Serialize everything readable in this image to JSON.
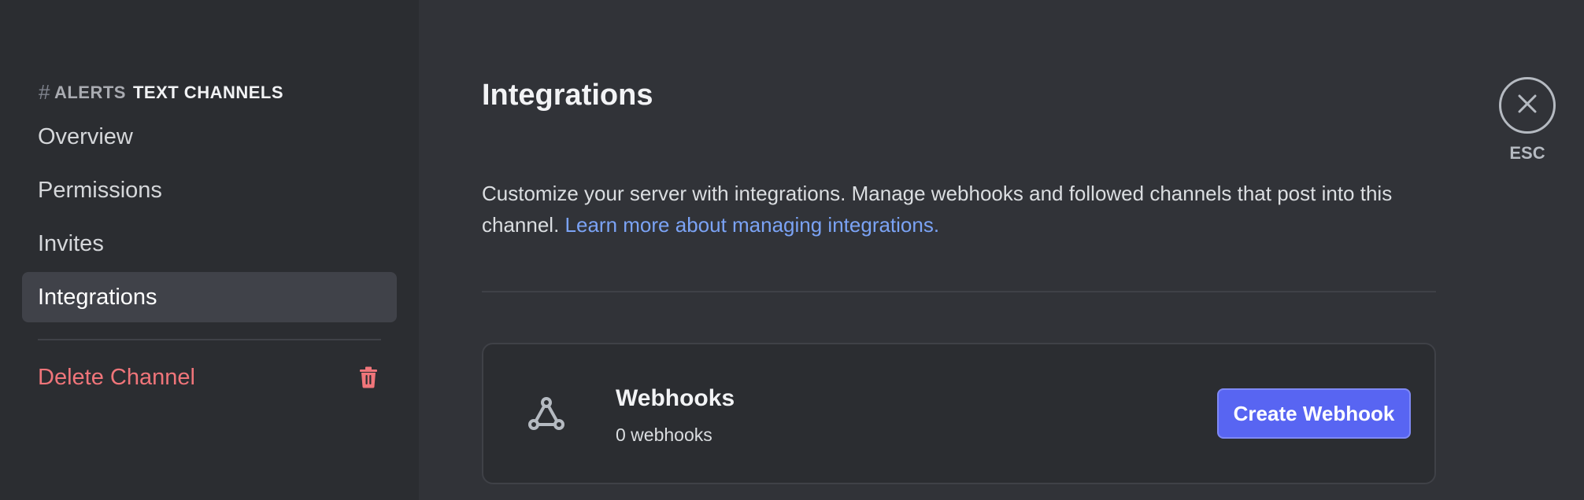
{
  "sidebar": {
    "header": {
      "hash": "#",
      "channel_name": "ALERTS",
      "category": "TEXT CHANNELS"
    },
    "items": [
      {
        "label": "Overview"
      },
      {
        "label": "Permissions"
      },
      {
        "label": "Invites"
      },
      {
        "label": "Integrations",
        "active": true
      }
    ],
    "delete_label": "Delete Channel"
  },
  "main": {
    "title": "Integrations",
    "description": "Customize your server with integrations. Manage webhooks and followed channels that post into this channel.",
    "learn_more_link": "Learn more about managing integrations.",
    "webhooks_card": {
      "title": "Webhooks",
      "subtitle": "0 webhooks",
      "button_label": "Create Webhook",
      "icon": "webhook-icon"
    }
  },
  "close": {
    "label": "ESC",
    "icon": "close-icon"
  },
  "colors": {
    "background": "#313338",
    "sidebar": "#2b2d31",
    "accent": "#5865f2",
    "danger": "#f0757a",
    "link": "#7ba3f5"
  }
}
